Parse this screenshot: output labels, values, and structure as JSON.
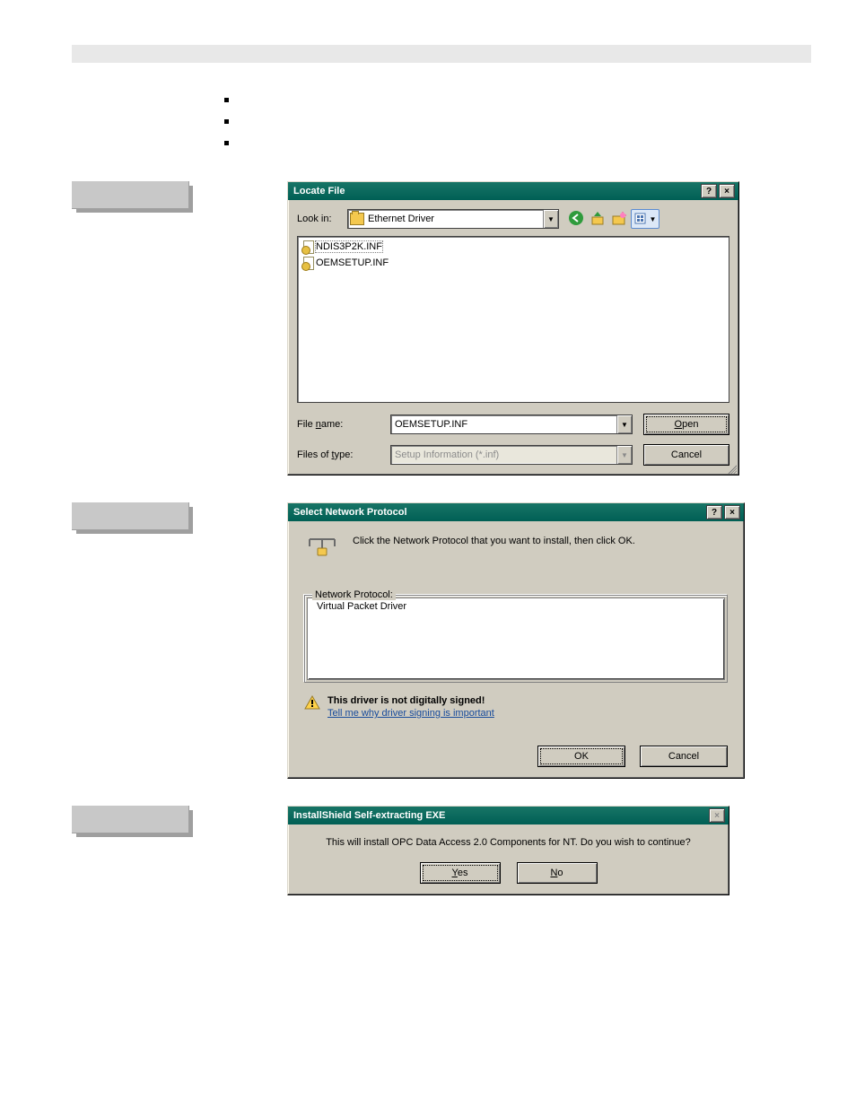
{
  "bullets": {
    "item0": "",
    "item1": "",
    "item2": ""
  },
  "dialog1": {
    "title": "Locate File",
    "helpBtn": "?",
    "closeBtn": "×",
    "lookInLabel": "Look in:",
    "lookInFolder": "Ethernet Driver",
    "toolbar": {
      "back": "back-icon",
      "up": "up-one-level-icon",
      "newFolder": "new-folder-icon",
      "views": "views-menu-icon"
    },
    "files": {
      "0": {
        "name": "NDIS3P2K.INF"
      },
      "1": {
        "name": "OEMSETUP.INF"
      }
    },
    "fileNameLabelPre": "File ",
    "fileNameLabelU": "n",
    "fileNameLabelPost": "ame:",
    "fileNameValue": "OEMSETUP.INF",
    "filesOfTypeLabelPre": "Files of ",
    "filesOfTypeLabelU": "t",
    "filesOfTypeLabelPost": "ype:",
    "filesOfTypeValue": "Setup Information (*.inf)",
    "openBtnU": "O",
    "openBtnRest": "pen",
    "cancelBtn": "Cancel"
  },
  "dialog2": {
    "title": "Select Network Protocol",
    "helpBtn": "?",
    "closeBtn": "×",
    "instruction": "Click the Network Protocol that you want to install, then click OK.",
    "groupLabel": "Network Protocol:",
    "protocolItem": "Virtual Packet Driver",
    "warnTitle": "This driver is not digitally signed!",
    "warnLink": "Tell me why driver signing is important",
    "okBtn": "OK",
    "cancelBtn": "Cancel"
  },
  "dialog3": {
    "title": "InstallShield Self-extracting EXE",
    "closeBtn": "×",
    "message": "This will install OPC Data Access 2.0 Components for NT. Do you wish to continue?",
    "yesBtnU": "Y",
    "yesBtnRest": "es",
    "noBtnU": "N",
    "noBtnRest": "o"
  }
}
